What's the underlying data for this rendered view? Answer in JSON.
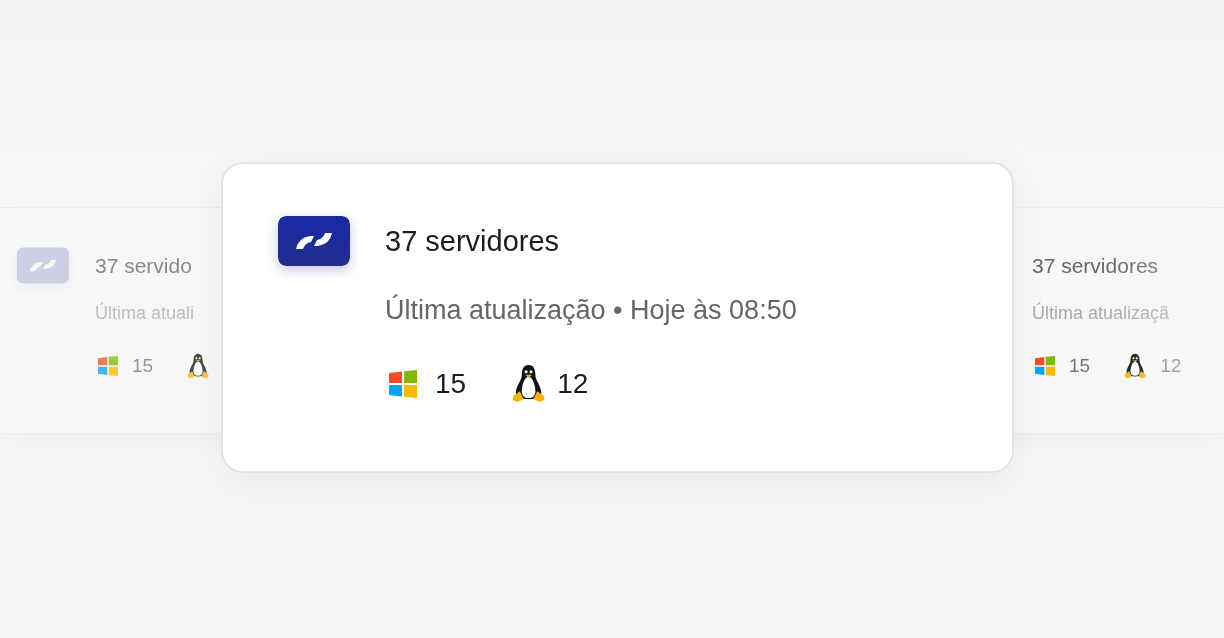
{
  "side_cards": [
    {
      "kind": "left",
      "title": "37 servido",
      "subtitle": "Última atuali",
      "windows_count": "15"
    },
    {
      "kind": "right",
      "title": "37 servidores",
      "subtitle": "Última atualizaçã",
      "windows_count": "15",
      "linux_count": "12"
    }
  ],
  "main_card": {
    "title": "37 servidores",
    "subtitle": "Última atualização • Hoje às 08:50",
    "windows_count": "15",
    "linux_count": "12"
  }
}
